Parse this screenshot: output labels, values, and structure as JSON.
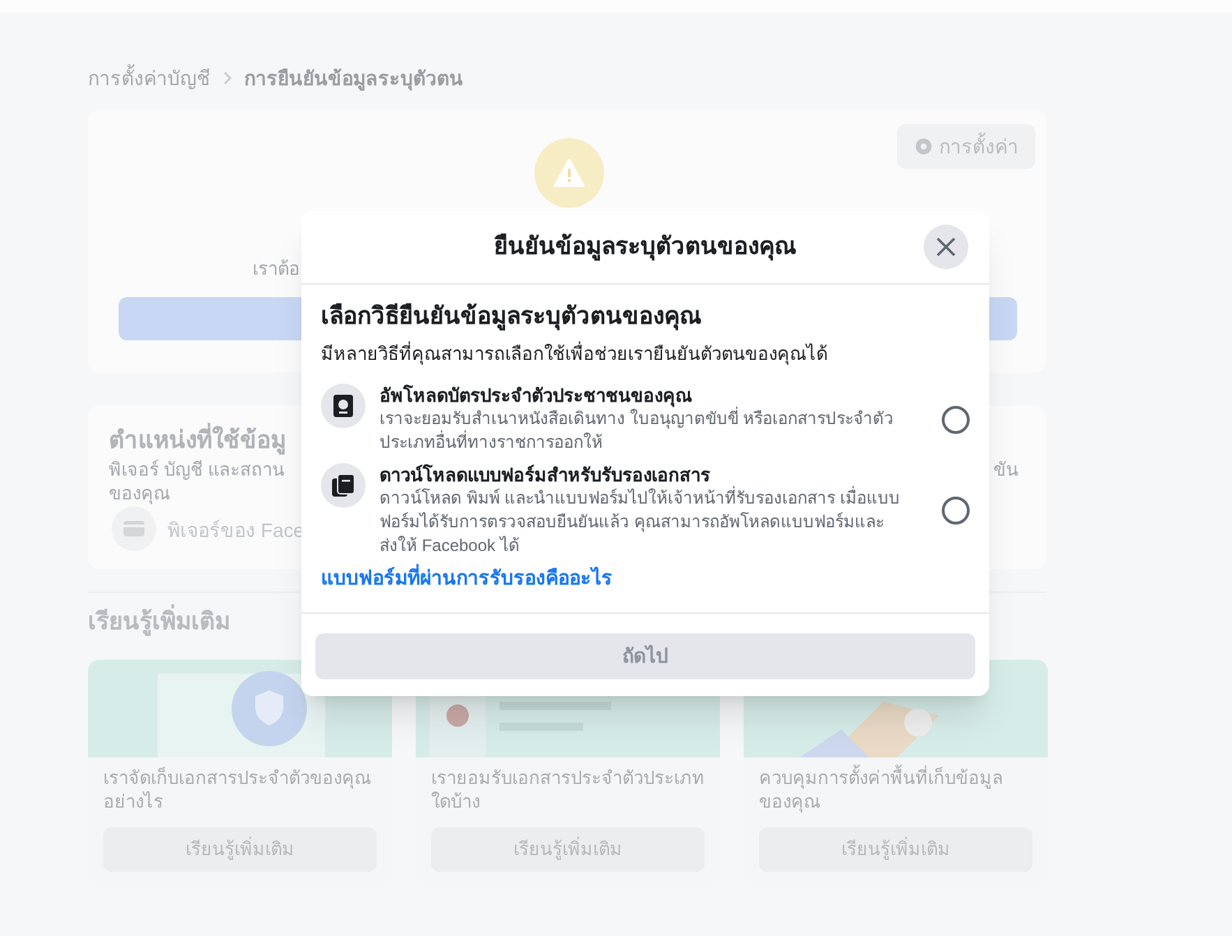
{
  "breadcrumb": [
    {
      "label": "การตั้งค่าบัญชี"
    },
    {
      "label": "การยืนยันข้อมูลระบุตัวตน"
    }
  ],
  "status_card": {
    "settings_button": "การตั้งค่า",
    "text_fragment": "เราต้อ"
  },
  "location_card": {
    "title": "ตำแหน่งที่ใช้ข้อมู",
    "description": "พิเจอร์ บัญชี และสถาน",
    "description_line_2": "ของคุณ",
    "description_right": "ขัน",
    "feature": "พิเจอร์ของ Face"
  },
  "learn_more": {
    "title": "เรียนรู้เพิ่มเติม",
    "cards": [
      {
        "kind": "storage",
        "text": "เราจัดเก็บเอกสารประจำตัวของคุณอย่างไร",
        "button": "เรียนรู้เพิ่มเติม"
      },
      {
        "kind": "documents",
        "text": "เรายอมรับเอกสารประจำตัวประเภทใดบ้าง",
        "button": "เรียนรู้เพิ่มเติม"
      },
      {
        "kind": "settings",
        "text": "ควบคุมการตั้งค่าพื้นที่เก็บข้อมูลของคุณ",
        "button": "เรียนรู้เพิ่มเติม"
      }
    ]
  },
  "dialog": {
    "title": "ยืนยันข้อมูลระบุตัวตนของคุณ",
    "heading": "เลือกวิธียืนยันข้อมูลระบุตัวตนของคุณ",
    "subtitle": "มีหลายวิธีที่คุณสามารถเลือกใช้เพื่อช่วยเรายืนยันตัวตนของคุณได้",
    "options": [
      {
        "kind": "id_card",
        "title": "อัพโหลดบัตรประจำตัวประชาชนของคุณ",
        "description": "เราจะยอมรับสำเนาหนังสือเดินทาง ใบอนุญาตขับขี่ หรือเอกสารประจำตัวประเภทอื่นที่ทางราชการออกให้",
        "selected": false
      },
      {
        "kind": "form",
        "title": "ดาวน์โหลดแบบฟอร์มสำหรับรับรองเอกสาร",
        "description": "ดาวน์โหลด พิมพ์ และนำแบบฟอร์มไปให้เจ้าหน้าที่รับรองเอกสาร เมื่อแบบฟอร์มได้รับการตรวจสอบยืนยันแล้ว คุณสามารถอัพโหลดแบบฟอร์มและส่งให้ Facebook ได้",
        "selected": false
      }
    ],
    "link": "แบบฟอร์มที่ผ่านการรับรองคืออะไร",
    "next_button": {
      "label": "ถัดไป",
      "disabled": true
    }
  }
}
